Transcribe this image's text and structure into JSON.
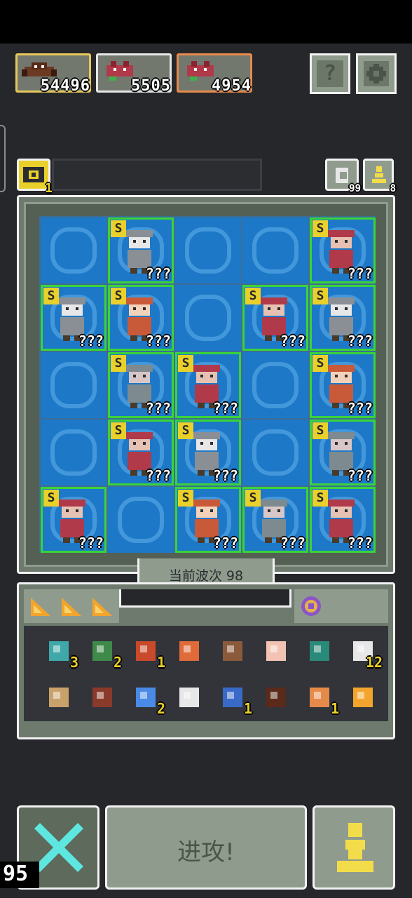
{
  "bosses": [
    {
      "value": "54496",
      "color": "#e6c85a"
    },
    {
      "value": "5505",
      "color": "#e7e7e7"
    },
    {
      "value": "4954",
      "color": "#e88a4a"
    }
  ],
  "top_buttons": {
    "help_label": "?",
    "settings_icon": "gear-icon"
  },
  "currency": {
    "count": "1",
    "icon": "coin-icon"
  },
  "counters": {
    "reroll_count": "99",
    "pawn_count": "8"
  },
  "grid": {
    "rows": [
      [
        {
          "s": false,
          "q": ""
        },
        {
          "s": true,
          "q": "???"
        },
        {
          "s": false,
          "q": ""
        },
        {
          "s": false,
          "q": ""
        },
        {
          "s": true,
          "q": "???"
        }
      ],
      [
        {
          "s": true,
          "q": "???"
        },
        {
          "s": true,
          "q": "???"
        },
        {
          "s": false,
          "q": ""
        },
        {
          "s": true,
          "q": "???"
        },
        {
          "s": true,
          "q": "???"
        }
      ],
      [
        {
          "s": false,
          "q": ""
        },
        {
          "s": true,
          "q": "???"
        },
        {
          "s": true,
          "q": "???"
        },
        {
          "s": false,
          "q": ""
        },
        {
          "s": true,
          "q": "???"
        }
      ],
      [
        {
          "s": false,
          "q": ""
        },
        {
          "s": true,
          "q": "???"
        },
        {
          "s": true,
          "q": "???"
        },
        {
          "s": false,
          "q": ""
        },
        {
          "s": true,
          "q": "???"
        }
      ],
      [
        {
          "s": true,
          "q": "???"
        },
        {
          "s": false,
          "q": ""
        },
        {
          "s": true,
          "q": "???"
        },
        {
          "s": true,
          "q": "???"
        },
        {
          "s": true,
          "q": "???"
        }
      ]
    ],
    "s_label": "S"
  },
  "wave": {
    "label": "当前波次 98"
  },
  "inventory": {
    "row1": [
      {
        "icon": "heart-shield-icon",
        "count": "3"
      },
      {
        "icon": "goblin-icon",
        "count": "2"
      },
      {
        "icon": "eye-orb-icon",
        "count": "1"
      },
      {
        "icon": "stick-icon",
        "count": ""
      },
      {
        "icon": "arrows-icon",
        "count": ""
      },
      {
        "icon": "hand-icon",
        "count": ""
      },
      {
        "icon": "table-icon",
        "count": ""
      },
      {
        "icon": "dice-icon",
        "count": "12"
      }
    ],
    "row2": [
      {
        "icon": "ship-icon",
        "count": ""
      },
      {
        "icon": "scroll-icon",
        "count": ""
      },
      {
        "icon": "crystal-icon",
        "count": "2"
      },
      {
        "icon": "spikes-icon",
        "count": ""
      },
      {
        "icon": "staff-icon",
        "count": "1"
      },
      {
        "icon": "trap-icon",
        "count": ""
      },
      {
        "icon": "hood-icon",
        "count": "1"
      },
      {
        "icon": "cog-icon",
        "count": ""
      }
    ]
  },
  "bottom": {
    "attack_label": "进攻!",
    "fps": "95"
  }
}
